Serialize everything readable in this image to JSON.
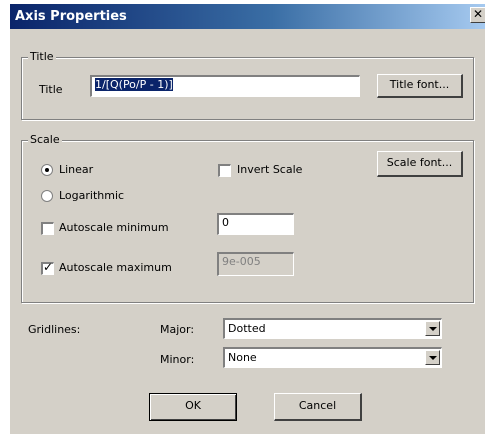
{
  "window": {
    "title": "Axis Properties",
    "close_glyph": "✕"
  },
  "title_group": {
    "legend": "Title",
    "label": "Title",
    "value": "1/[Q(Po/P - 1)]",
    "font_button": "Title font..."
  },
  "scale_group": {
    "legend": "Scale",
    "linear_label": "Linear",
    "logarithmic_label": "Logarithmic",
    "selected": "Linear",
    "invert_label": "Invert Scale",
    "invert_checked": false,
    "font_button": "Scale font...",
    "autoscale_min_label": "Autoscale minimum",
    "autoscale_min_checked": false,
    "min_value": "0",
    "autoscale_max_label": "Autoscale maximum",
    "autoscale_max_checked": true,
    "max_value": "9e-005"
  },
  "gridlines": {
    "label": "Gridlines:",
    "major_label": "Major:",
    "major_value": "Dotted",
    "minor_label": "Minor:",
    "minor_value": "None"
  },
  "buttons": {
    "ok": "OK",
    "cancel": "Cancel"
  },
  "icons": {
    "close": "close-icon",
    "dropdown": "chevron-down-icon",
    "radio": "radio-icon",
    "checkbox": "checkbox-icon"
  },
  "colors": {
    "titlebar": "#0a246a",
    "face": "#d4d0c8",
    "selection": "#0a246a"
  }
}
